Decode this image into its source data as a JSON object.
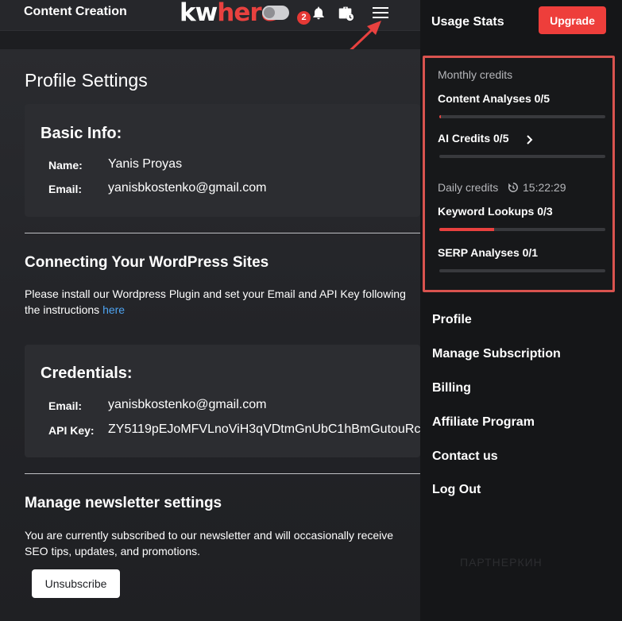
{
  "header": {
    "app_title": "Content Creation",
    "logo_kw": "kw",
    "logo_here": "here",
    "notifications_count": "2"
  },
  "profile": {
    "title": "Profile Settings",
    "basic_info": {
      "title": "Basic Info:",
      "name_label": "Name:",
      "name_value": "Yanis Proyas",
      "email_label": "Email:",
      "email_value": "yanisbkostenko@gmail.com"
    },
    "wordpress": {
      "title": "Connecting Your WordPress Sites",
      "text": "Please install our Wordpress Plugin and set your Email and API Key following the instructions ",
      "link": "here"
    },
    "credentials": {
      "title": "Credentials:",
      "email_label": "Email:",
      "email_value": "yanisbkostenko@gmail.com",
      "api_key_label": "API Key:",
      "api_key_value": "ZY5119pEJoMFVLnoViH3qVDtmGnUbC1hBmGutouRc"
    },
    "newsletter": {
      "title": "Manage newsletter settings",
      "text": "You are currently subscribed to our newsletter and will occasionally receive SEO tips, updates, and promotions.",
      "button": "Unsubscribe"
    }
  },
  "panel": {
    "title": "Usage Stats",
    "upgrade": "Upgrade",
    "monthly_caption": "Monthly credits",
    "content_analyses": {
      "label": "Content Analyses 0/5",
      "progress": 0.01
    },
    "ai_credits": {
      "label": "AI Credits 0/5",
      "progress": 0
    },
    "daily_caption": "Daily credits",
    "timer": "15:22:29",
    "keyword_lookups": {
      "label": "Keyword Lookups 0/3",
      "progress": 0.33
    },
    "serp_analyses": {
      "label": "SERP Analyses 0/1",
      "progress": 0
    },
    "menu": [
      "Profile",
      "Manage Subscription",
      "Billing",
      "Affiliate Program",
      "Contact us",
      "Log Out"
    ],
    "watermark": "ПАРТНЕРКИН"
  },
  "colors": {
    "accent": "#e8413f",
    "link": "#4ea3f0"
  },
  "icons": [
    "bell-icon",
    "briefcase-clock-icon",
    "hamburger-menu-icon",
    "refresh-clock-icon",
    "chevron-right-icon",
    "arrow-annotation-icon"
  ]
}
